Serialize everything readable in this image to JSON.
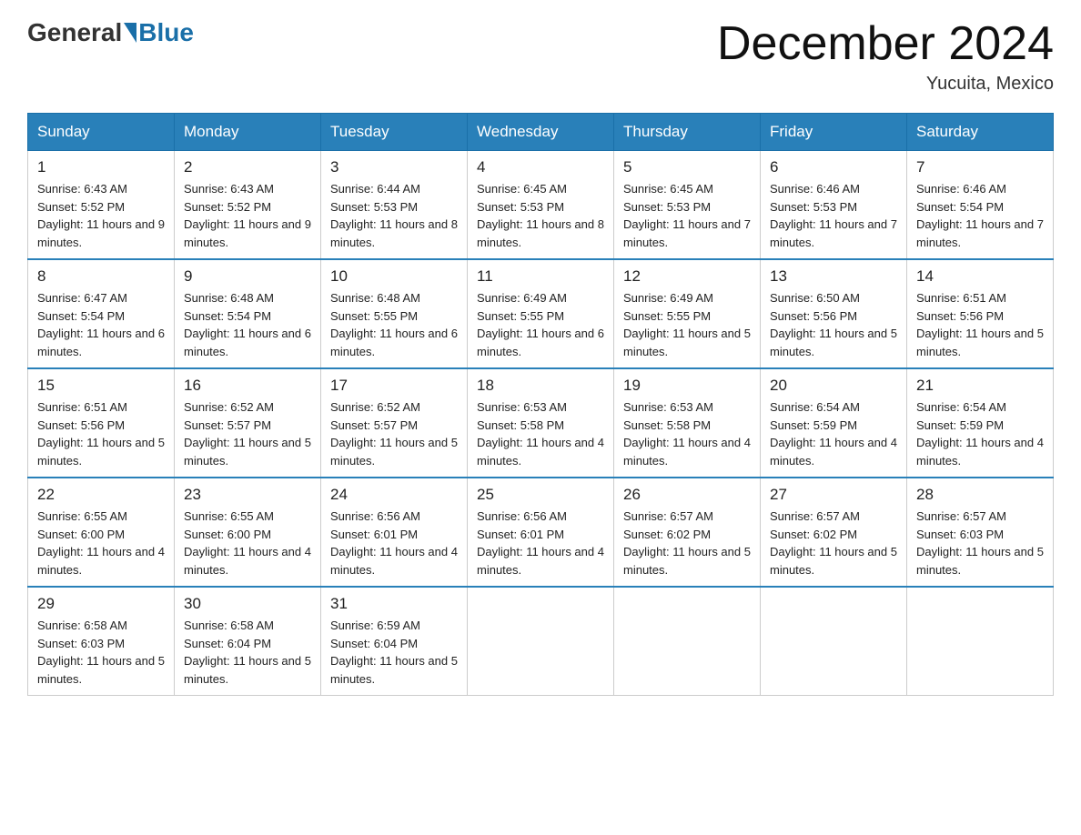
{
  "header": {
    "logo_general": "General",
    "logo_blue": "Blue",
    "month_title": "December 2024",
    "location": "Yucuita, Mexico"
  },
  "days_of_week": [
    "Sunday",
    "Monday",
    "Tuesday",
    "Wednesday",
    "Thursday",
    "Friday",
    "Saturday"
  ],
  "weeks": [
    [
      {
        "day": "1",
        "sunrise": "6:43 AM",
        "sunset": "5:52 PM",
        "daylight": "11 hours and 9 minutes."
      },
      {
        "day": "2",
        "sunrise": "6:43 AM",
        "sunset": "5:52 PM",
        "daylight": "11 hours and 9 minutes."
      },
      {
        "day": "3",
        "sunrise": "6:44 AM",
        "sunset": "5:53 PM",
        "daylight": "11 hours and 8 minutes."
      },
      {
        "day": "4",
        "sunrise": "6:45 AM",
        "sunset": "5:53 PM",
        "daylight": "11 hours and 8 minutes."
      },
      {
        "day": "5",
        "sunrise": "6:45 AM",
        "sunset": "5:53 PM",
        "daylight": "11 hours and 7 minutes."
      },
      {
        "day": "6",
        "sunrise": "6:46 AM",
        "sunset": "5:53 PM",
        "daylight": "11 hours and 7 minutes."
      },
      {
        "day": "7",
        "sunrise": "6:46 AM",
        "sunset": "5:54 PM",
        "daylight": "11 hours and 7 minutes."
      }
    ],
    [
      {
        "day": "8",
        "sunrise": "6:47 AM",
        "sunset": "5:54 PM",
        "daylight": "11 hours and 6 minutes."
      },
      {
        "day": "9",
        "sunrise": "6:48 AM",
        "sunset": "5:54 PM",
        "daylight": "11 hours and 6 minutes."
      },
      {
        "day": "10",
        "sunrise": "6:48 AM",
        "sunset": "5:55 PM",
        "daylight": "11 hours and 6 minutes."
      },
      {
        "day": "11",
        "sunrise": "6:49 AM",
        "sunset": "5:55 PM",
        "daylight": "11 hours and 6 minutes."
      },
      {
        "day": "12",
        "sunrise": "6:49 AM",
        "sunset": "5:55 PM",
        "daylight": "11 hours and 5 minutes."
      },
      {
        "day": "13",
        "sunrise": "6:50 AM",
        "sunset": "5:56 PM",
        "daylight": "11 hours and 5 minutes."
      },
      {
        "day": "14",
        "sunrise": "6:51 AM",
        "sunset": "5:56 PM",
        "daylight": "11 hours and 5 minutes."
      }
    ],
    [
      {
        "day": "15",
        "sunrise": "6:51 AM",
        "sunset": "5:56 PM",
        "daylight": "11 hours and 5 minutes."
      },
      {
        "day": "16",
        "sunrise": "6:52 AM",
        "sunset": "5:57 PM",
        "daylight": "11 hours and 5 minutes."
      },
      {
        "day": "17",
        "sunrise": "6:52 AM",
        "sunset": "5:57 PM",
        "daylight": "11 hours and 5 minutes."
      },
      {
        "day": "18",
        "sunrise": "6:53 AM",
        "sunset": "5:58 PM",
        "daylight": "11 hours and 4 minutes."
      },
      {
        "day": "19",
        "sunrise": "6:53 AM",
        "sunset": "5:58 PM",
        "daylight": "11 hours and 4 minutes."
      },
      {
        "day": "20",
        "sunrise": "6:54 AM",
        "sunset": "5:59 PM",
        "daylight": "11 hours and 4 minutes."
      },
      {
        "day": "21",
        "sunrise": "6:54 AM",
        "sunset": "5:59 PM",
        "daylight": "11 hours and 4 minutes."
      }
    ],
    [
      {
        "day": "22",
        "sunrise": "6:55 AM",
        "sunset": "6:00 PM",
        "daylight": "11 hours and 4 minutes."
      },
      {
        "day": "23",
        "sunrise": "6:55 AM",
        "sunset": "6:00 PM",
        "daylight": "11 hours and 4 minutes."
      },
      {
        "day": "24",
        "sunrise": "6:56 AM",
        "sunset": "6:01 PM",
        "daylight": "11 hours and 4 minutes."
      },
      {
        "day": "25",
        "sunrise": "6:56 AM",
        "sunset": "6:01 PM",
        "daylight": "11 hours and 4 minutes."
      },
      {
        "day": "26",
        "sunrise": "6:57 AM",
        "sunset": "6:02 PM",
        "daylight": "11 hours and 5 minutes."
      },
      {
        "day": "27",
        "sunrise": "6:57 AM",
        "sunset": "6:02 PM",
        "daylight": "11 hours and 5 minutes."
      },
      {
        "day": "28",
        "sunrise": "6:57 AM",
        "sunset": "6:03 PM",
        "daylight": "11 hours and 5 minutes."
      }
    ],
    [
      {
        "day": "29",
        "sunrise": "6:58 AM",
        "sunset": "6:03 PM",
        "daylight": "11 hours and 5 minutes."
      },
      {
        "day": "30",
        "sunrise": "6:58 AM",
        "sunset": "6:04 PM",
        "daylight": "11 hours and 5 minutes."
      },
      {
        "day": "31",
        "sunrise": "6:59 AM",
        "sunset": "6:04 PM",
        "daylight": "11 hours and 5 minutes."
      },
      null,
      null,
      null,
      null
    ]
  ],
  "labels": {
    "sunrise": "Sunrise:",
    "sunset": "Sunset:",
    "daylight": "Daylight:"
  }
}
